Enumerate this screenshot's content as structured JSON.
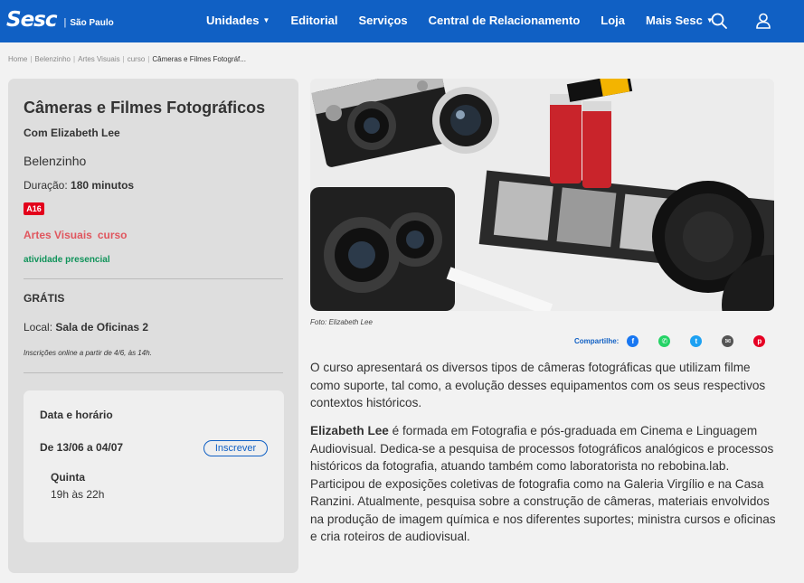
{
  "header": {
    "logo_word": "Sesc",
    "logo_separator": "|",
    "logo_city": "São Paulo",
    "nav": [
      {
        "label": "Unidades",
        "has_caret": true
      },
      {
        "label": "Editorial",
        "has_caret": false
      },
      {
        "label": "Serviços",
        "has_caret": false
      },
      {
        "label": "Central de Relacionamento",
        "has_caret": false
      },
      {
        "label": "Loja",
        "has_caret": false
      },
      {
        "label": "Mais Sesc",
        "has_caret": true
      }
    ],
    "icons": [
      "search-icon",
      "user-icon"
    ],
    "color": "#1060c4"
  },
  "breadcrumb": [
    "Home",
    "Belenzinho",
    "Artes Visuais",
    "curso",
    "Câmeras e Filmes Fotográf..."
  ],
  "event": {
    "title": "Câmeras e Filmes Fotográficos",
    "subtitle": "Com Elizabeth Lee",
    "unit": "Belenzinho",
    "duration_label": "Duração:",
    "duration_value": "180 minutos",
    "age_rating": "A16",
    "categories": [
      "Artes Visuais",
      "curso"
    ],
    "mode": "atividade presencial",
    "price": "GRÁTIS",
    "local_label": "Local:",
    "local_value": "Sala de Oficinas 2",
    "registration": "Inscrições online a partir de 4/6, às 14h."
  },
  "schedule": {
    "title": "Data e horário",
    "dates": "De 13/06 a 04/07",
    "button": "Inscrever",
    "day": "Quinta",
    "time": "19h às 22h"
  },
  "photo": {
    "caption": "Foto: Elizabeth Lee"
  },
  "share": {
    "label": "Compartilhe:",
    "icons": [
      {
        "name": "facebook-icon",
        "color": "#1877f2"
      },
      {
        "name": "whatsapp-icon",
        "color": "#25d366"
      },
      {
        "name": "twitter-icon",
        "color": "#1da1f2"
      },
      {
        "name": "email-icon",
        "color": "#555555"
      },
      {
        "name": "pinterest-icon",
        "color": "#e60023"
      }
    ]
  },
  "description": "O curso apresentará os diversos tipos de câmeras fotográficas que utilizam filme como suporte, tal como, a evolução desses equipamentos com os seus respectivos contextos históricos.",
  "bio": {
    "name": "Elizabeth Lee",
    "text": " é formada em Fotografia e pós-graduada em Cinema e Linguagem Audiovisual. Dedica-se a pesquisa de processos fotográficos analógicos e processos históricos da fotografia, atuando também como laboratorista no rebobina.lab. Participou de exposições coletivas de fotografia como na Galeria Virgílio e na Casa Ranzini. Atualmente, pesquisa sobre a construção de câmeras, materiais envolvidos na produção de imagem química e nos diferentes suportes; ministra cursos e oficinas e cria roteiros de audiovisual."
  }
}
